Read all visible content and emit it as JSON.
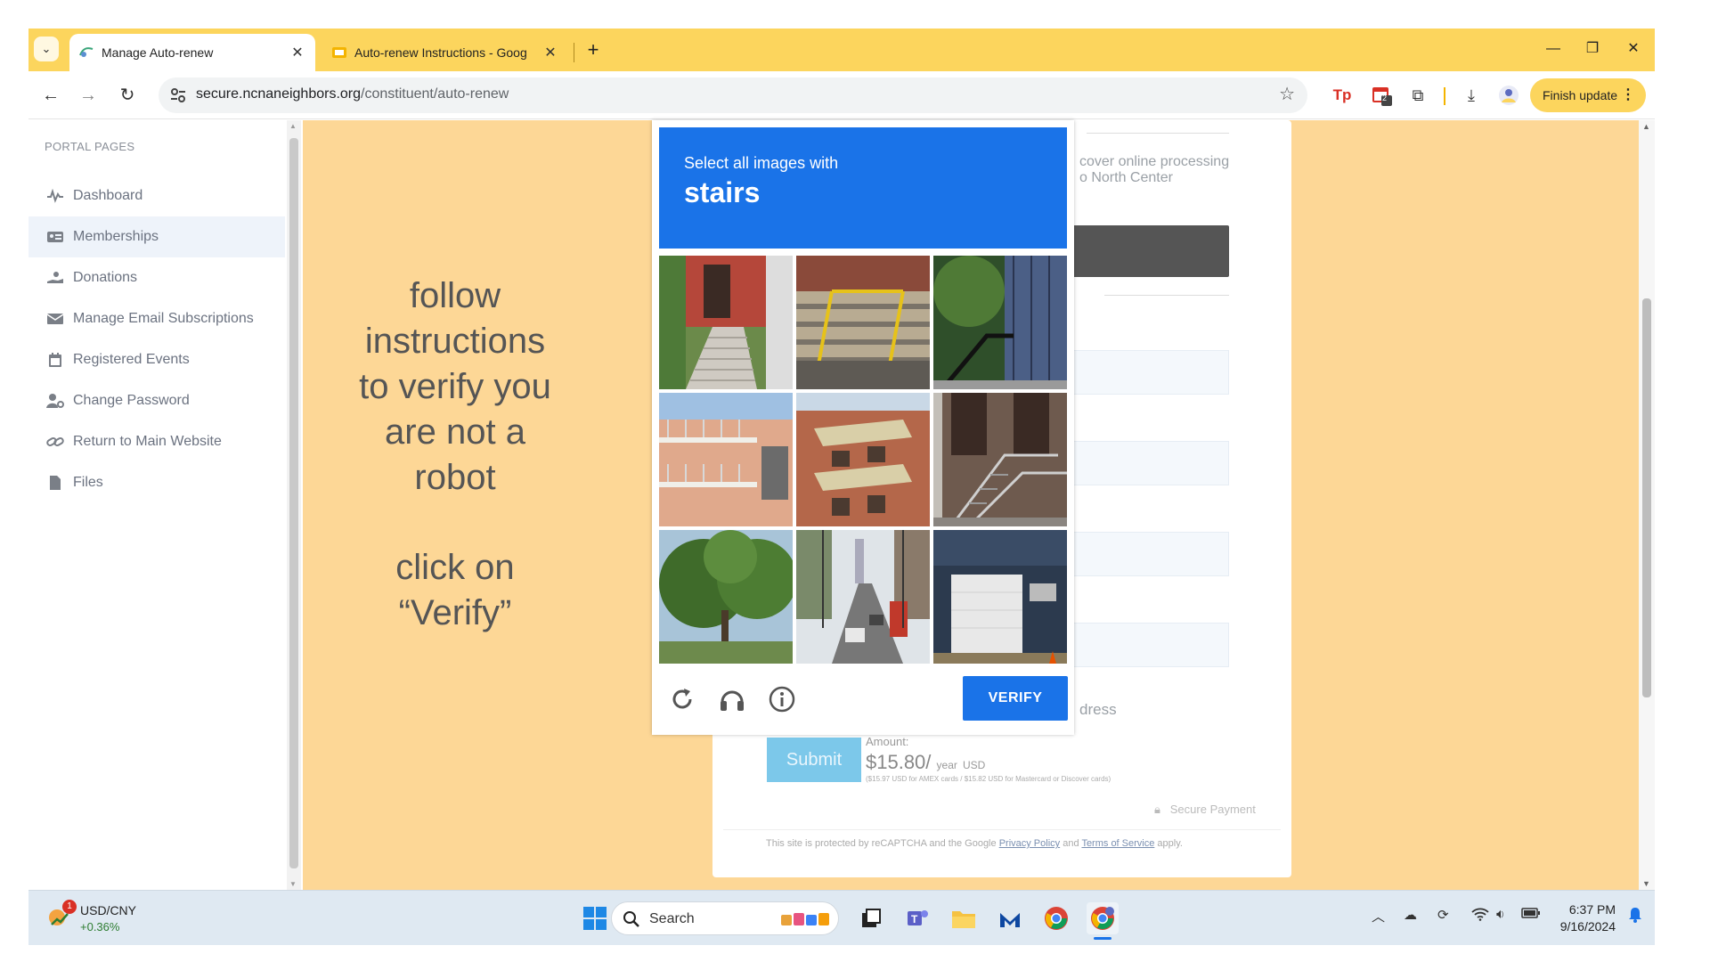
{
  "browser": {
    "tabs": [
      {
        "title": "Manage Auto-renew",
        "active": true
      },
      {
        "title": "Auto-renew Instructions - Goog",
        "active": false
      }
    ],
    "address": {
      "host": "secure.ncnaneighbors.org",
      "path": "/constituent/auto-renew"
    },
    "finish_update": "Finish update",
    "ext_badge": "2",
    "new_tab": "+"
  },
  "sidebar": {
    "heading": "PORTAL PAGES",
    "items": [
      {
        "label": "Dashboard",
        "icon": "pulse-icon"
      },
      {
        "label": "Memberships",
        "icon": "id-card-icon",
        "active": true
      },
      {
        "label": "Donations",
        "icon": "hand-donation-icon"
      },
      {
        "label": "Manage Email Subscriptions",
        "icon": "envelope-icon"
      },
      {
        "label": "Registered Events",
        "icon": "calendar-icon"
      },
      {
        "label": "Change Password",
        "icon": "user-gear-icon"
      },
      {
        "label": "Return to Main Website",
        "icon": "link-icon"
      },
      {
        "label": "Files",
        "icon": "file-icon"
      }
    ]
  },
  "overlay_instructions": {
    "line1": "follow",
    "line2": "instructions",
    "line3": "to verify you",
    "line4": "are not a",
    "line5": "robot",
    "line6": "click on",
    "line7": "“Verify”"
  },
  "captcha": {
    "prompt": "Select all images with",
    "target": "stairs",
    "verify_label": "VERIFY"
  },
  "form": {
    "partial_text_1": "cover online processing",
    "partial_text_2": "o North Center",
    "partial_address": "dress",
    "submit_label": "Submit",
    "amount_label": "Amount:",
    "amount_value": "$15.80/",
    "amount_unit": "year",
    "amount_currency": "USD",
    "amount_note": "($15.97 USD for AMEX cards / $15.82 USD for Mastercard or Discover cards)",
    "secure_payment": "Secure Payment",
    "recaptcha_notice_prefix": "This site is protected by reCAPTCHA and the Google",
    "privacy_policy": "Privacy Policy",
    "and": "and",
    "terms": "Terms of Service",
    "apply": "apply."
  },
  "taskbar": {
    "ticker": "USD/CNY",
    "ticker_change": "+0.36%",
    "ticker_badge": "1",
    "search_placeholder": "Search",
    "time": "6:37 PM",
    "date": "9/16/2024"
  },
  "colors": {
    "chrome_yellow": "#fcd55d",
    "page_background": "#fdd796",
    "captcha_blue": "#1a73e8",
    "submit_blue": "#7cc8ea"
  }
}
